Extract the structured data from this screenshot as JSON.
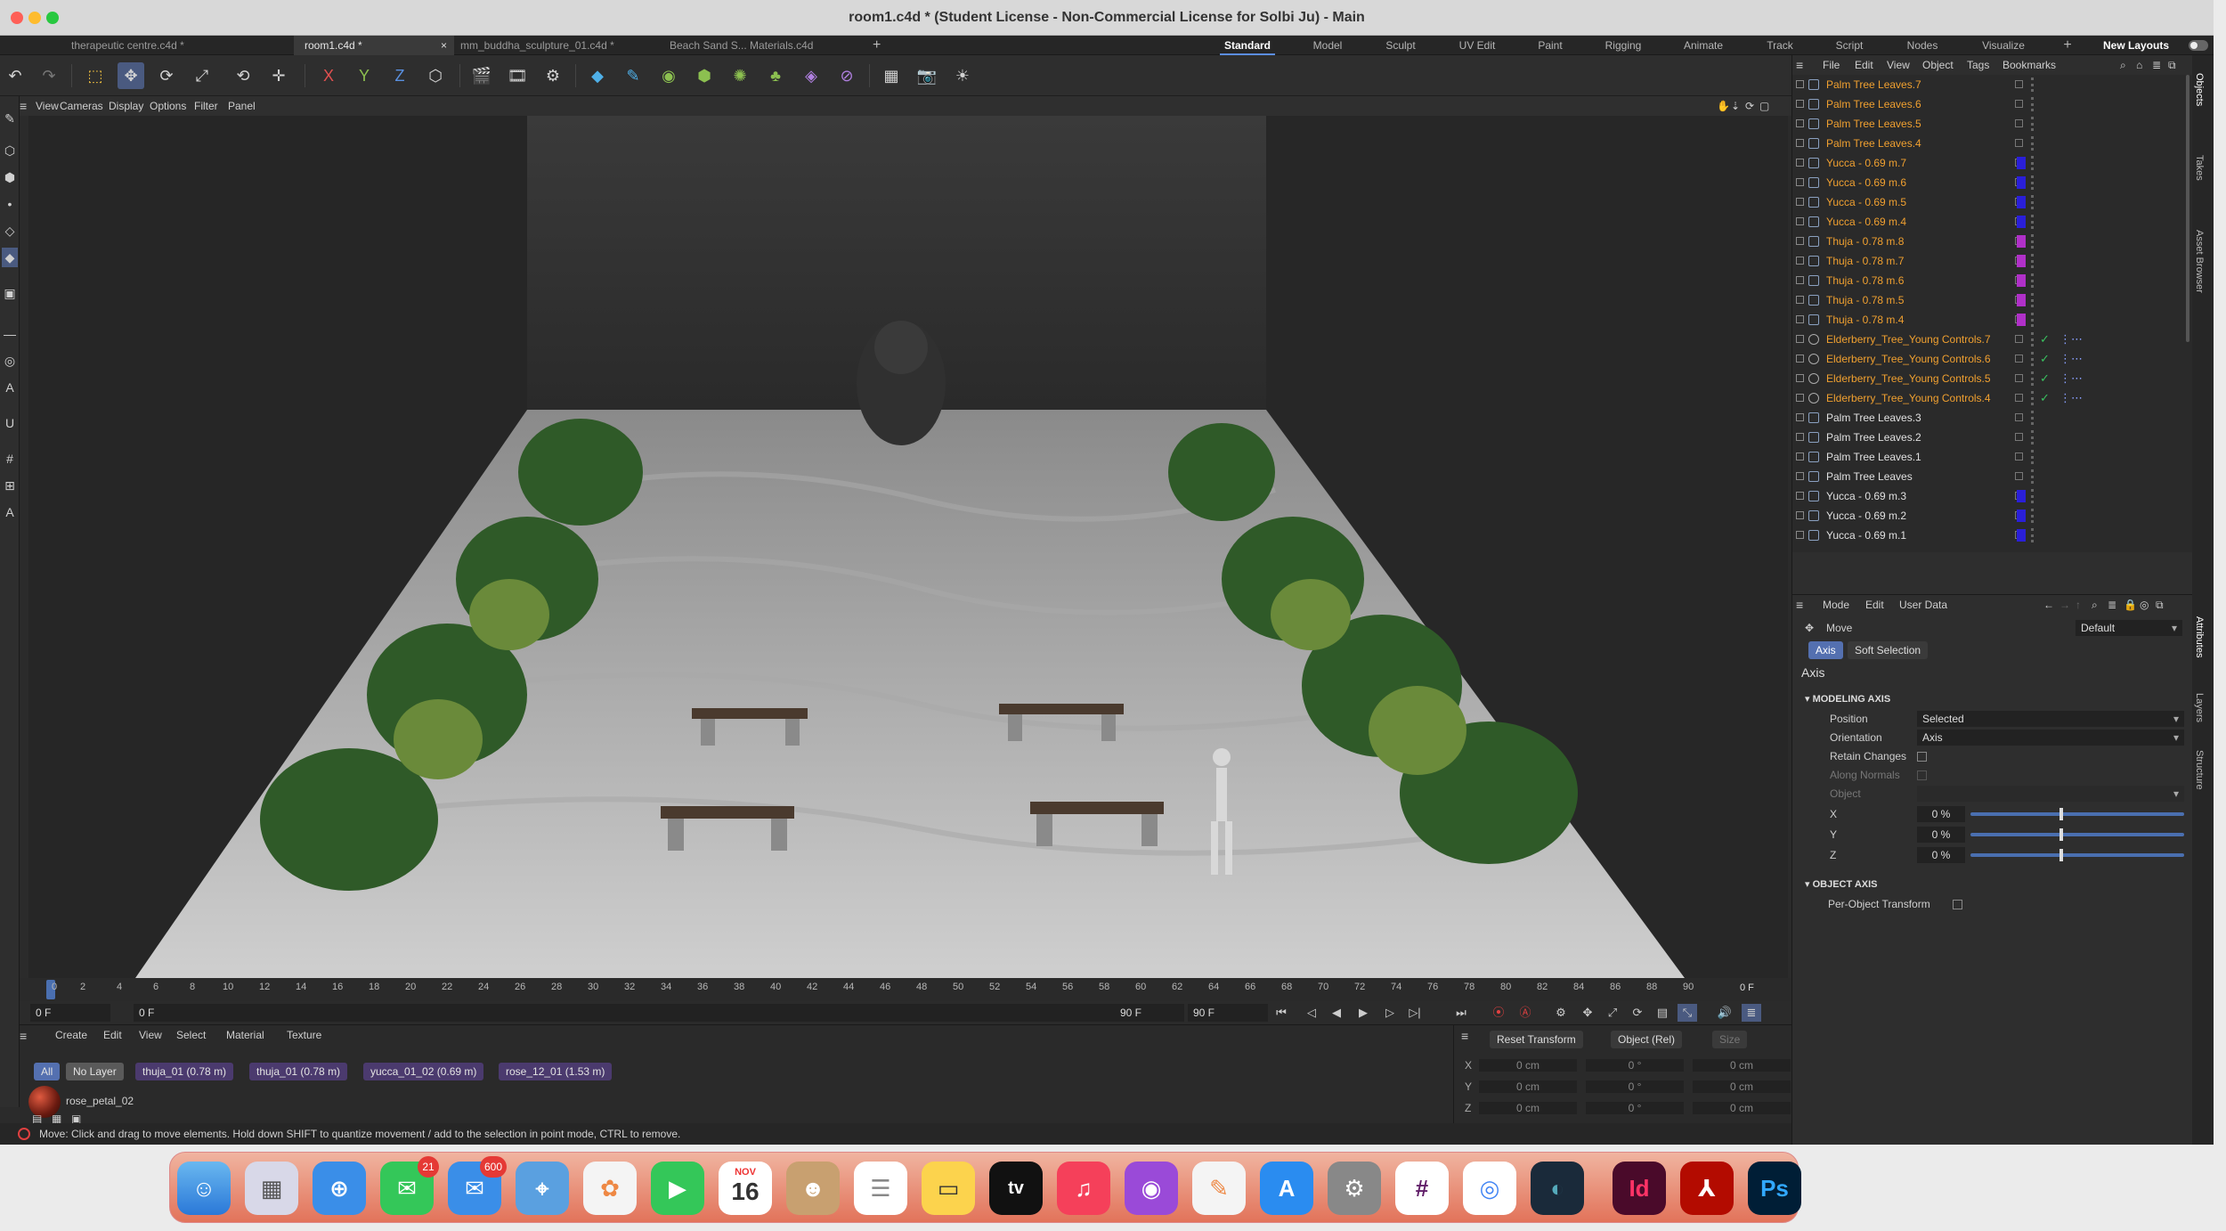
{
  "window": {
    "title": "room1.c4d * (Student License - Non-Commercial License for Solbi Ju) - Main"
  },
  "tabs": [
    "therapeutic centre.c4d *",
    "room1.c4d *",
    "mm_buddha_sculpture_01.c4d *",
    "Beach Sand  S... Materials.c4d"
  ],
  "active_tab": "room1.c4d *",
  "tab_close": "×",
  "tab_add": "+",
  "layouts": [
    "Standard",
    "Model",
    "Sculpt",
    "UV Edit",
    "Paint",
    "Rigging",
    "Animate",
    "Track",
    "Script",
    "Nodes",
    "Visualize"
  ],
  "active_layout": "Standard",
  "new_layouts": "New Layouts",
  "toolbar": {
    "x": "X",
    "y": "Y",
    "z": "Z"
  },
  "viewport_menu": [
    "View",
    "Cameras",
    "Display",
    "Options",
    "Filter",
    "Panel"
  ],
  "timeline": {
    "ticks": [
      "0",
      "2",
      "4",
      "6",
      "8",
      "10",
      "12",
      "14",
      "16",
      "18",
      "20",
      "22",
      "24",
      "26",
      "28",
      "30",
      "32",
      "34",
      "36",
      "38",
      "40",
      "42",
      "44",
      "46",
      "48",
      "50",
      "52",
      "54",
      "56",
      "58",
      "60",
      "62",
      "64",
      "66",
      "68",
      "70",
      "72",
      "74",
      "76",
      "78",
      "80",
      "82",
      "84",
      "86",
      "88",
      "90"
    ],
    "current": "0 F"
  },
  "transport": {
    "start": "0 F",
    "min": "0 F",
    "max": "90 F",
    "end": "90 F"
  },
  "material_menu": [
    "Create",
    "Edit",
    "View",
    "Select",
    "Material",
    "Texture"
  ],
  "layer_chips": [
    "All",
    "No Layer",
    "thuja_01 (0.78 m)",
    "thuja_01 (0.78 m)",
    "yucca_01_02 (0.69 m)",
    "rose_12_01 (1.53 m)"
  ],
  "material": {
    "name": "rose_petal_02"
  },
  "coordinates": {
    "reset": "Reset Transform",
    "mode": "Object (Rel)",
    "size": "Size",
    "rows": [
      {
        "axis": "X",
        "p": "0 cm",
        "r": "0 °",
        "s": "0 cm"
      },
      {
        "axis": "Y",
        "p": "0 cm",
        "r": "0 °",
        "s": "0 cm"
      },
      {
        "axis": "Z",
        "p": "0 cm",
        "r": "0 °",
        "s": "0 cm"
      }
    ]
  },
  "status": "Move: Click and drag to move elements. Hold down SHIFT to quantize movement / add to the selection in point mode, CTRL to remove.",
  "object_menu": [
    "File",
    "Edit",
    "View",
    "Object",
    "Tags",
    "Bookmarks"
  ],
  "objects": [
    {
      "name": "Palm Tree  Leaves.7",
      "orange": true,
      "color": ""
    },
    {
      "name": "Palm Tree  Leaves.6",
      "orange": true,
      "color": ""
    },
    {
      "name": "Palm Tree  Leaves.5",
      "orange": true,
      "color": ""
    },
    {
      "name": "Palm Tree  Leaves.4",
      "orange": true,
      "color": ""
    },
    {
      "name": "Yucca - 0.69 m.7",
      "orange": true,
      "color": "#2a1fd8"
    },
    {
      "name": "Yucca - 0.69 m.6",
      "orange": true,
      "color": "#2a1fd8"
    },
    {
      "name": "Yucca - 0.69 m.5",
      "orange": true,
      "color": "#2a1fd8"
    },
    {
      "name": "Yucca - 0.69 m.4",
      "orange": true,
      "color": "#2a1fd8"
    },
    {
      "name": "Thuja - 0.78 m.8",
      "orange": true,
      "color": "#b030c8"
    },
    {
      "name": "Thuja - 0.78 m.7",
      "orange": true,
      "color": "#b030c8"
    },
    {
      "name": "Thuja - 0.78 m.6",
      "orange": true,
      "color": "#b030c8"
    },
    {
      "name": "Thuja - 0.78 m.5",
      "orange": true,
      "color": "#b030c8"
    },
    {
      "name": "Thuja - 0.78 m.4",
      "orange": true,
      "color": "#b030c8"
    },
    {
      "name": "Elderberry_Tree_Young Controls.7",
      "orange": true,
      "color": "",
      "null": true
    },
    {
      "name": "Elderberry_Tree_Young Controls.6",
      "orange": true,
      "color": "",
      "null": true
    },
    {
      "name": "Elderberry_Tree_Young Controls.5",
      "orange": true,
      "color": "",
      "null": true
    },
    {
      "name": "Elderberry_Tree_Young Controls.4",
      "orange": true,
      "color": "",
      "null": true
    },
    {
      "name": "Palm Tree  Leaves.3",
      "orange": false,
      "color": ""
    },
    {
      "name": "Palm Tree  Leaves.2",
      "orange": false,
      "color": ""
    },
    {
      "name": "Palm Tree  Leaves.1",
      "orange": false,
      "color": ""
    },
    {
      "name": "Palm Tree  Leaves",
      "orange": false,
      "color": ""
    },
    {
      "name": "Yucca - 0.69 m.3",
      "orange": false,
      "color": "#2a1fd8"
    },
    {
      "name": "Yucca - 0.69 m.2",
      "orange": false,
      "color": "#2a1fd8"
    },
    {
      "name": "Yucca - 0.69 m.1",
      "orange": false,
      "color": "#2a1fd8"
    }
  ],
  "attr_menu": [
    "Mode",
    "Edit",
    "User Data"
  ],
  "attributes": {
    "tool": "Move",
    "preset": "Default",
    "tabs": [
      "Axis",
      "Soft Selection"
    ],
    "heading": "Axis",
    "modeling_axis": "MODELING AXIS",
    "position_label": "Position",
    "position_value": "Selected",
    "orientation_label": "Orientation",
    "orientation_value": "Axis",
    "retain": "Retain Changes",
    "along": "Along Normals",
    "object": "Object",
    "x": "X",
    "y": "Y",
    "z": "Z",
    "pct": "0 %",
    "object_axis": "OBJECT AXIS",
    "per_object": "Per-Object Transform"
  },
  "side_tabs": [
    "Objects",
    "Takes",
    "Asset Browser",
    "Attributes",
    "Layers",
    "Structure"
  ],
  "dock": {
    "messages_badge": "21",
    "mail_badge": "600",
    "calendar_month": "NOV",
    "calendar_day": "16",
    "tv": "tv",
    "indesign": "Id",
    "photoshop": "Ps"
  }
}
